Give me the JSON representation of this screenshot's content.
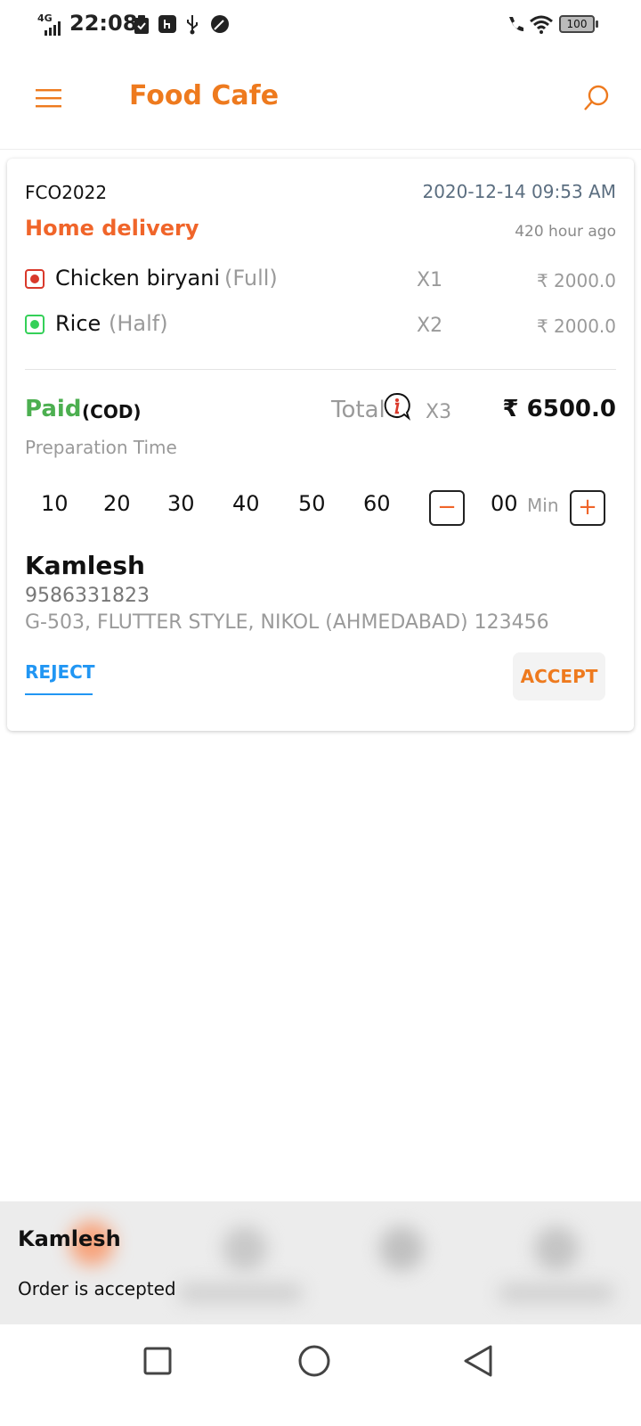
{
  "status_bar": {
    "network": "4G",
    "time": "22:08",
    "battery": "100"
  },
  "app_bar": {
    "title": "Food Cafe"
  },
  "order": {
    "id": "FCO2022",
    "date": "2020-12-14 09:53 AM",
    "type": "Home delivery",
    "age": "420 hour ago",
    "items": [
      {
        "name": "Chicken biryani",
        "size": "(Full)",
        "qty": "X1",
        "price": "₹ 2000.0",
        "diet": "non-veg"
      },
      {
        "name": "Rice",
        "size": "(Half)",
        "qty": "X2",
        "price": "₹ 2000.0",
        "diet": "veg"
      }
    ],
    "payment_status": "Paid",
    "payment_method": "(COD)",
    "total_label": "Total",
    "total_qty": "X3",
    "total_amount": "₹ 6500.0"
  },
  "preparation": {
    "label": "Preparation Time",
    "options": [
      "10",
      "20",
      "30",
      "40",
      "50",
      "60"
    ],
    "minutes": "00",
    "unit": "Min"
  },
  "customer": {
    "name": "Kamlesh",
    "phone": "9586331823",
    "address": "G-503, FLUTTER STYLE, NIKOL (AHMEDABAD) 123456"
  },
  "actions": {
    "reject": "REJECT",
    "accept": "ACCEPT"
  },
  "toast": {
    "title": "Kamlesh",
    "message": "Order is accepted"
  },
  "colors": {
    "brand": "#ee7a1e",
    "delivery": "#f0652a",
    "paid": "#4caf50",
    "reject": "#2196f3",
    "non_veg": "#d9392b",
    "veg": "#34d058"
  }
}
